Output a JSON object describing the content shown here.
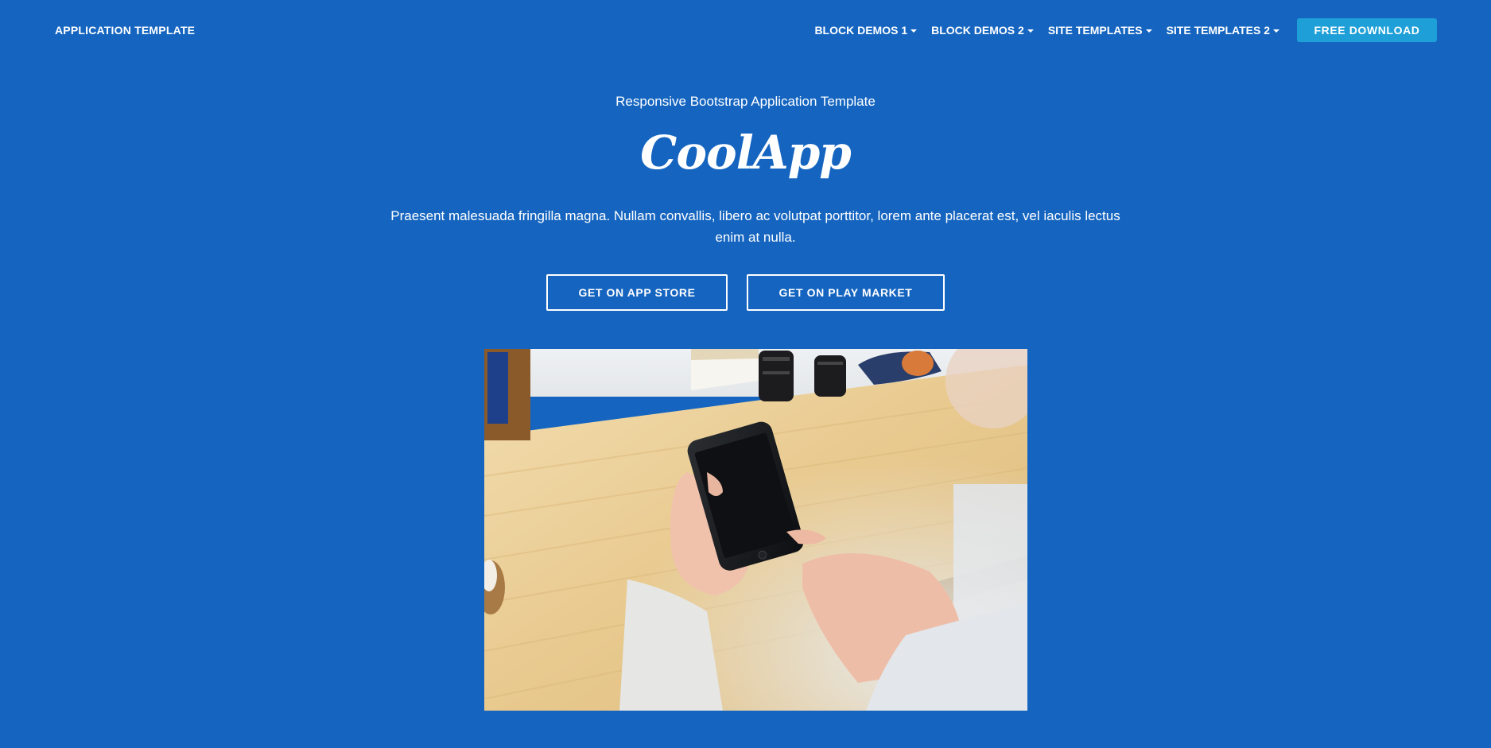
{
  "navbar": {
    "brand": "APPLICATION TEMPLATE",
    "items": [
      {
        "label": "BLOCK DEMOS 1"
      },
      {
        "label": "BLOCK DEMOS 2"
      },
      {
        "label": "SITE TEMPLATES"
      },
      {
        "label": "SITE TEMPLATES 2"
      }
    ],
    "download_label": "FREE DOWNLOAD"
  },
  "hero": {
    "subtitle": "Responsive Bootstrap Application Template",
    "title": "CoolApp",
    "description": "Praesent malesuada fringilla magna. Nullam convallis, libero ac volutpat porttitor, lorem ante placerat est, vel iaculis lectus enim at nulla.",
    "buttons": {
      "app_store": "GET ON APP STORE",
      "play_market": "GET ON PLAY MARKET"
    }
  },
  "colors": {
    "background": "#1565c0",
    "download_button": "#1e9fd8",
    "text": "#ffffff"
  }
}
